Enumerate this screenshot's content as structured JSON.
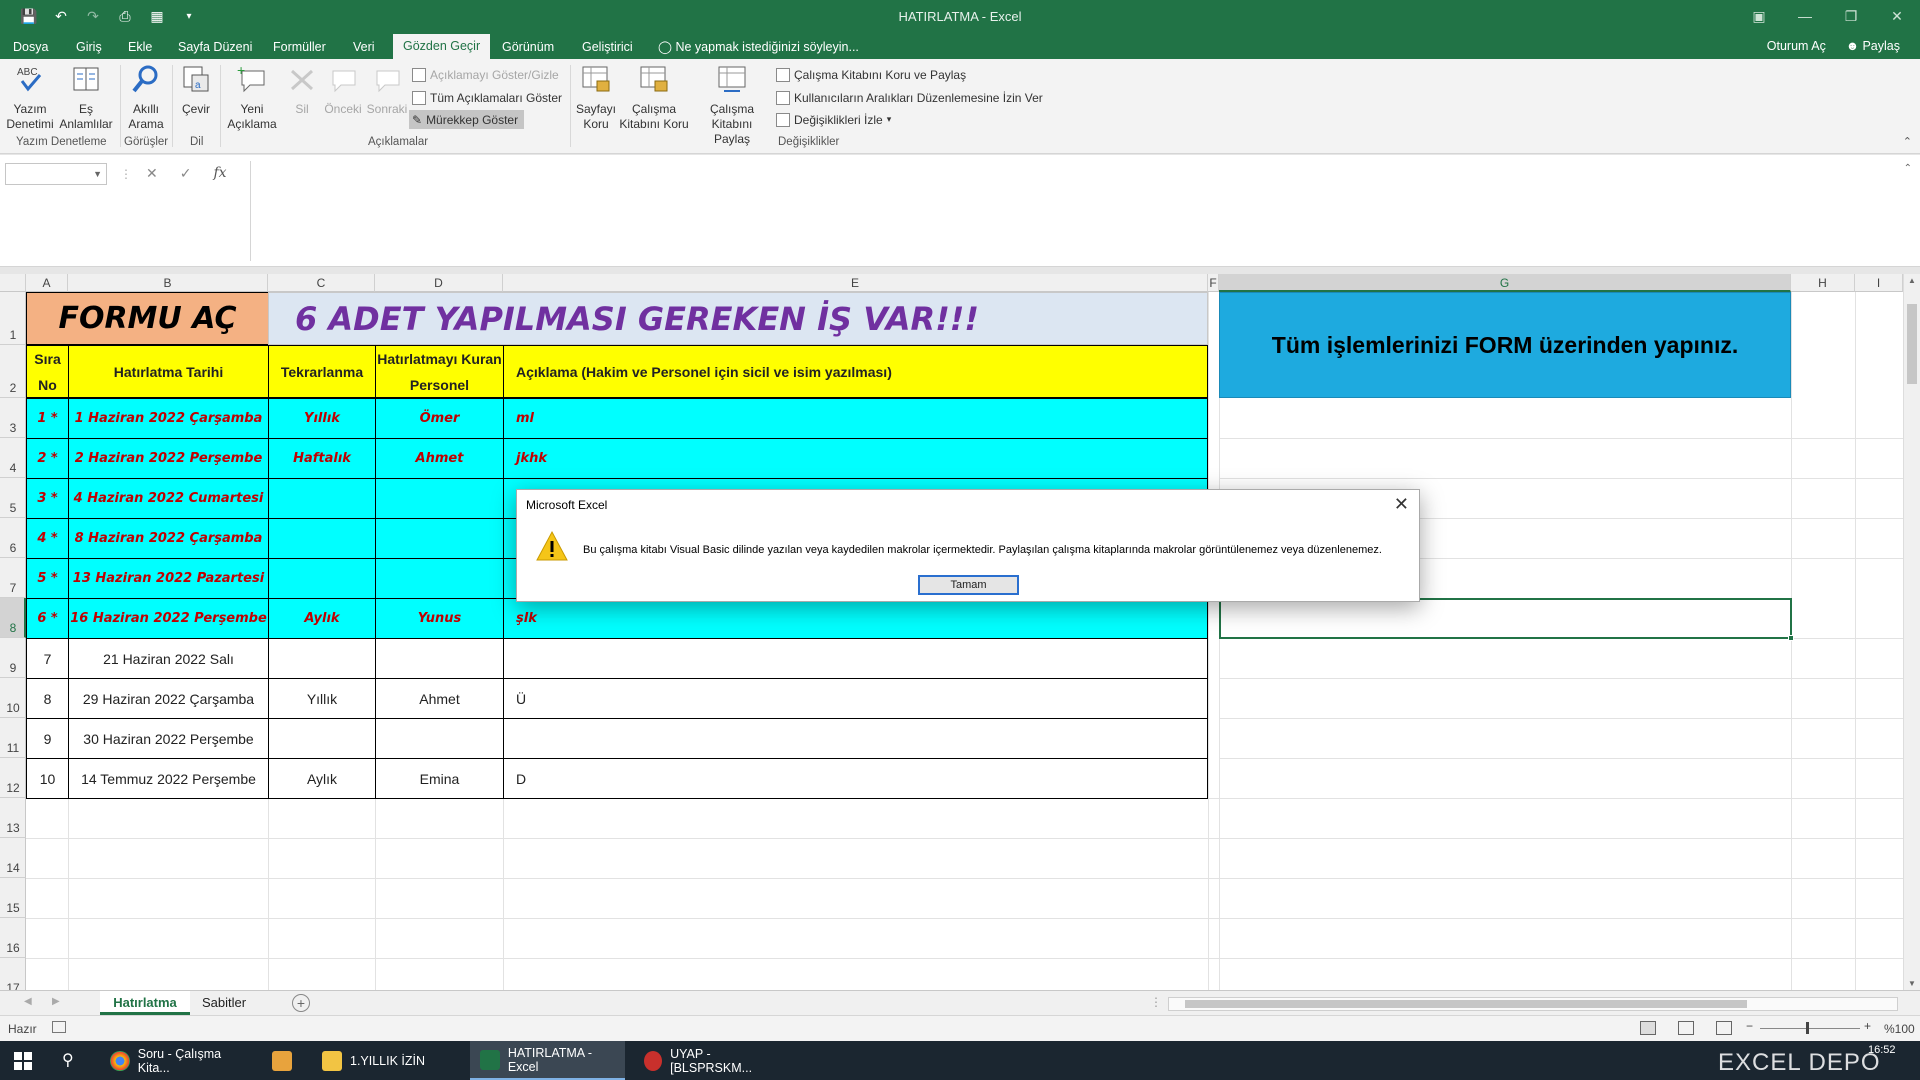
{
  "window": {
    "title": "HATIRLATMA - Excel"
  },
  "ribbon_tabs": [
    "Dosya",
    "Giriş",
    "Ekle",
    "Sayfa Düzeni",
    "Formüller",
    "Veri",
    "Gözden Geçir",
    "Görünüm",
    "Geliştirici"
  ],
  "active_tab": "Gözden Geçir",
  "tell_me": "Ne yapmak istediğinizi söyleyin...",
  "account": {
    "sign_in": "Oturum Aç",
    "share": "Paylaş"
  },
  "ribbon": {
    "spelling": "Yazım Denetimi",
    "thesaurus": "Eş Anlamlılar",
    "smart_lookup": "Akıllı Arama",
    "translate": "Çevir",
    "new_comment": "Yeni Açıklama",
    "delete": "Sil",
    "previous": "Önceki",
    "next": "Sonraki",
    "show_hide_comment": "Açıklamayı Göster/Gizle",
    "show_all_comments": "Tüm Açıklamaları Göster",
    "show_ink": "Mürekkep Göster",
    "protect_sheet": "Sayfayı Koru",
    "protect_workbook": "Çalışma Kitabını Koru",
    "share_workbook": "Çalışma Kitabını Paylaş",
    "protect_share": "Çalışma Kitabını Koru ve Paylaş",
    "allow_edit_ranges": "Kullanıcıların Aralıkları Düzenlemesine İzin Ver",
    "track_changes": "Değişiklikleri İzle",
    "groups": {
      "proofing": "Yazım Denetleme",
      "insights": "Görüşler",
      "language": "Dil",
      "comments": "Açıklamalar",
      "changes": "Değişiklikler"
    }
  },
  "columns": [
    "A",
    "B",
    "C",
    "D",
    "E",
    "F",
    "G",
    "H",
    "I"
  ],
  "rows": [
    "1",
    "2",
    "3",
    "4",
    "5",
    "6",
    "7",
    "8",
    "9",
    "10",
    "11",
    "12",
    "13",
    "14",
    "15",
    "16",
    "17"
  ],
  "sheet": {
    "form_button": "FORMU AÇ",
    "banner": "6 ADET YAPILMASI GEREKEN İŞ VAR!!!",
    "info_box": "Tüm işlemlerinizi FORM üzerinden yapınız.",
    "headers": [
      "Sıra No",
      "Hatırlatma Tarihi",
      "Tekrarlanma",
      "Hatırlatmayı Kuran Personel",
      "Açıklama (Hakim ve Personel için sicil ve isim yazılması)"
    ],
    "records": [
      {
        "no": "1 *",
        "date": "1 Haziran 2022 Çarşamba",
        "repeat": "Yıllık",
        "person": "Ömer",
        "note": "ml",
        "due": true
      },
      {
        "no": "2 *",
        "date": "2 Haziran 2022 Perşembe",
        "repeat": "Haftalık",
        "person": "Ahmet",
        "note": "jkhk",
        "due": true
      },
      {
        "no": "3 *",
        "date": "4 Haziran 2022 Cumartesi",
        "repeat": "",
        "person": "",
        "note": "",
        "due": true
      },
      {
        "no": "4 *",
        "date": "8 Haziran 2022 Çarşamba",
        "repeat": "",
        "person": "",
        "note": "",
        "due": true
      },
      {
        "no": "5 *",
        "date": "13 Haziran 2022 Pazartesi",
        "repeat": "",
        "person": "",
        "note": "",
        "due": true
      },
      {
        "no": "6 *",
        "date": "16 Haziran 2022 Perşembe",
        "repeat": "Aylık",
        "person": "Yunus",
        "note": "şlk",
        "due": true
      },
      {
        "no": "7",
        "date": "21 Haziran 2022 Salı",
        "repeat": "",
        "person": "",
        "note": "",
        "due": false
      },
      {
        "no": "8",
        "date": "29 Haziran 2022 Çarşamba",
        "repeat": "Yıllık",
        "person": "Ahmet",
        "note": "Ü",
        "due": false
      },
      {
        "no": "9",
        "date": "30 Haziran 2022 Perşembe",
        "repeat": "",
        "person": "",
        "note": "",
        "due": false
      },
      {
        "no": "10",
        "date": "14 Temmuz 2022 Perşembe",
        "repeat": "Aylık",
        "person": "Emina",
        "note": "D",
        "due": false
      }
    ]
  },
  "sheet_tabs": [
    "Hatırlatma",
    "Sabitler"
  ],
  "status": {
    "ready": "Hazır",
    "zoom": "%100"
  },
  "dialog": {
    "title": "Microsoft Excel",
    "message": "Bu çalışma kitabı Visual Basic dilinde yazılan veya kaydedilen makrolar içermektedir. Paylaşılan çalışma kitaplarında makrolar görüntülenemez veya düzenlenemez.",
    "ok": "Tamam"
  },
  "taskbar": {
    "items": [
      "Soru - Çalışma Kita...",
      "1.YILLIK İZİN",
      "HATIRLATMA - Excel",
      "UYAP - [BLSPRSKM..."
    ],
    "clock": "16:52"
  },
  "watermark": "EXCEL DEPO",
  "colors": {
    "excel_green": "#217346",
    "cyan": "#00ffff",
    "yellow": "#ffff00",
    "orange": "#f4b183",
    "blue": "#1eaadf",
    "purple": "#7030a0"
  }
}
